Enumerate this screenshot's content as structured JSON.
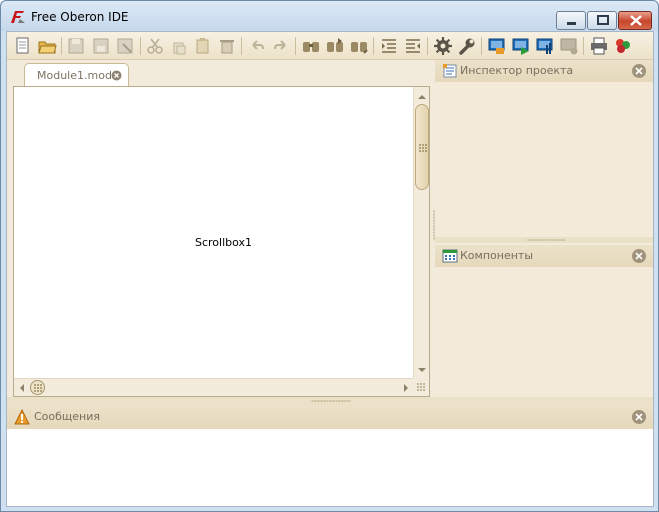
{
  "window": {
    "title": "Free Oberon IDE"
  },
  "toolbar": {
    "buttons": [
      {
        "icon": "new-file-icon"
      },
      {
        "icon": "open-folder-icon"
      },
      {
        "icon": "save-icon"
      },
      {
        "icon": "save-as-icon"
      },
      {
        "icon": "save-all-icon"
      },
      {
        "icon": "cut-icon"
      },
      {
        "icon": "copy-icon"
      },
      {
        "icon": "paste-icon"
      },
      {
        "icon": "delete-icon"
      },
      {
        "icon": "undo-icon"
      },
      {
        "icon": "redo-icon"
      },
      {
        "icon": "find-icon"
      },
      {
        "icon": "find-next-icon"
      },
      {
        "icon": "replace-icon"
      },
      {
        "icon": "indent-icon"
      },
      {
        "icon": "unindent-icon"
      },
      {
        "icon": "settings-gear-icon"
      },
      {
        "icon": "tools-wrench-icon"
      },
      {
        "icon": "compile-icon"
      },
      {
        "icon": "run-icon"
      },
      {
        "icon": "build-icon"
      },
      {
        "icon": "stop-icon"
      },
      {
        "icon": "print-icon"
      },
      {
        "icon": "components-icon"
      }
    ]
  },
  "editor": {
    "tab_label": "Module1.mod",
    "content_label": "Scrollbox1"
  },
  "panels": {
    "inspector": {
      "title": "Инспектор проекта"
    },
    "components": {
      "title": "Компоненты"
    },
    "messages": {
      "title": "Сообщения"
    }
  },
  "colors": {
    "panel_header": "#e8dcc0",
    "toolbar_bg": "#f1e8d3",
    "accent_orange": "#e89a2a",
    "blue_icon": "#1f6fb8",
    "green_icon": "#2d9b3c"
  }
}
